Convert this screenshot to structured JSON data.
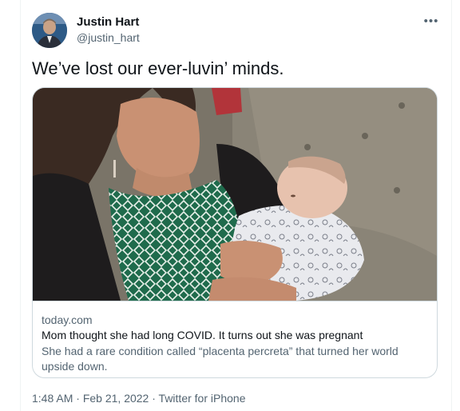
{
  "author": {
    "name": "Justin Hart",
    "handle": "@justin_hart"
  },
  "menu": {
    "more_label": "•••"
  },
  "tweet": {
    "text": "We’ve lost our ever-luvin’ minds."
  },
  "card": {
    "domain": "today.com",
    "title": "Mom thought she had long COVID. It turns out she was pregnant",
    "description": "She had a rare condition called “placenta percreta” that turned her world upside down."
  },
  "meta": {
    "time": "1:48 AM",
    "separator": " · ",
    "date": "Feb 21, 2022",
    "source": "Twitter for iPhone"
  },
  "colors": {
    "text_primary": "#0f1419",
    "text_secondary": "#536471",
    "border": "#cfd9de"
  }
}
